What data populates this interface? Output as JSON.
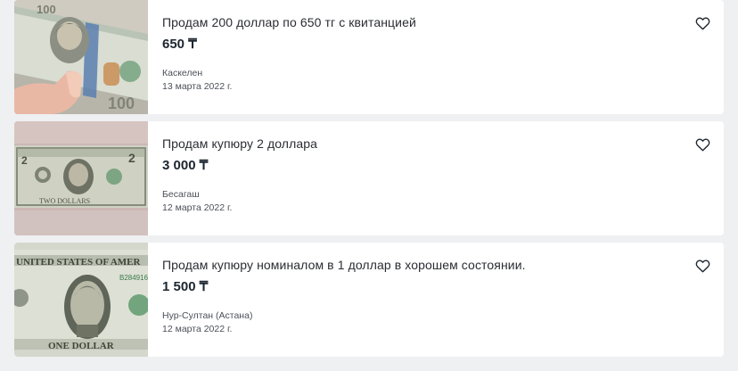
{
  "listings": [
    {
      "title": "Продам 200 доллар по 650 тг с квитанцией",
      "price": "650 ₸",
      "city": "Каскелен",
      "date": "13 марта 2022 г.",
      "photo_icon": "hundred-dollar-bill-photo",
      "fav_icon": "heart-outline-icon"
    },
    {
      "title": "Продам купюру 2 доллара",
      "price": "3 000 ₸",
      "city": "Бесагаш",
      "date": "12 марта 2022 г.",
      "photo_icon": "two-dollar-bill-photo",
      "fav_icon": "heart-outline-icon"
    },
    {
      "title": "Продам купюру номиналом в 1 доллар в хорошем состоянии.",
      "price": "1 500 ₸",
      "city": "Нур-Султан (Астана)",
      "date": "12 марта 2022 г.",
      "photo_icon": "one-dollar-bill-photo",
      "fav_icon": "heart-outline-icon"
    }
  ],
  "colors": {
    "background": "#eef0f2",
    "card": "#ffffff",
    "title": "#2b2d33",
    "price": "#1d2630",
    "meta": "#4b5058"
  }
}
